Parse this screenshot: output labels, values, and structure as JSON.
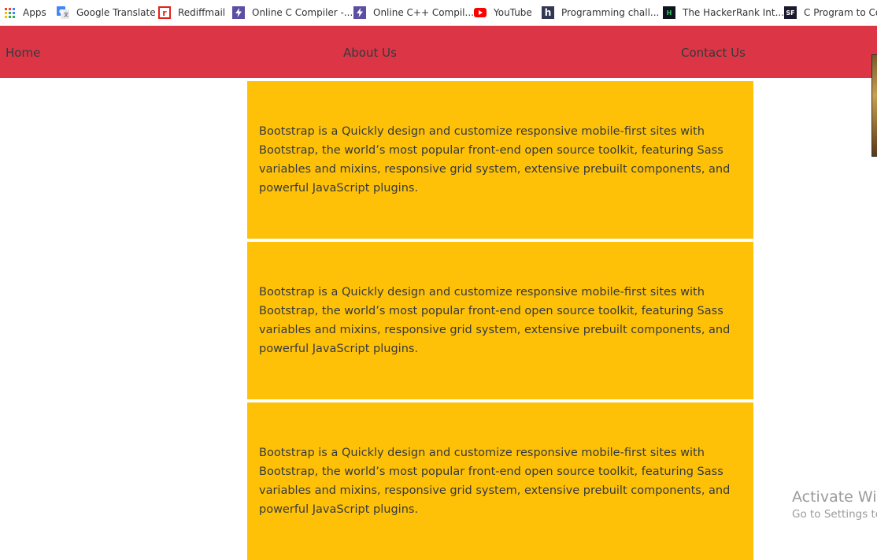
{
  "bookmarks": {
    "apps_label": "Apps",
    "items": [
      {
        "label": "Google Translate",
        "icon": "google-translate-icon"
      },
      {
        "label": "Rediffmail",
        "icon": "rediffmail-icon"
      },
      {
        "label": "Online C Compiler -...",
        "icon": "bolt-icon"
      },
      {
        "label": "Online C++ Compil...",
        "icon": "bolt-icon"
      },
      {
        "label": "YouTube",
        "icon": "youtube-icon"
      },
      {
        "label": "Programming chall...",
        "icon": "hackerearth-icon"
      },
      {
        "label": "The HackerRank Int...",
        "icon": "hackerrank-icon"
      },
      {
        "label": "C Program to Cor",
        "icon": "sf-icon"
      }
    ]
  },
  "navbar": {
    "background": "#dc3545",
    "links": [
      "Home",
      "About Us",
      "Contact Us"
    ]
  },
  "cards": {
    "background": "#ffc107",
    "items": [
      {
        "text": "Bootstrap is a Quickly design and customize responsive mobile-first sites with Bootstrap, the world’s most popular front-end open source toolkit, featuring Sass variables and mixins, responsive grid system, extensive prebuilt components, and powerful JavaScript plugins."
      },
      {
        "text": "Bootstrap is a Quickly design and customize responsive mobile-first sites with Bootstrap, the world’s most popular front-end open source toolkit, featuring Sass variables and mixins, responsive grid system, extensive prebuilt components, and powerful JavaScript plugins."
      },
      {
        "text": "Bootstrap is a Quickly design and customize responsive mobile-first sites with Bootstrap, the world’s most popular front-end open source toolkit, featuring Sass variables and mixins, responsive grid system, extensive prebuilt components, and powerful JavaScript plugins."
      }
    ]
  },
  "watermark": {
    "title": "Activate Wir",
    "subtitle": "Go to Settings to"
  }
}
